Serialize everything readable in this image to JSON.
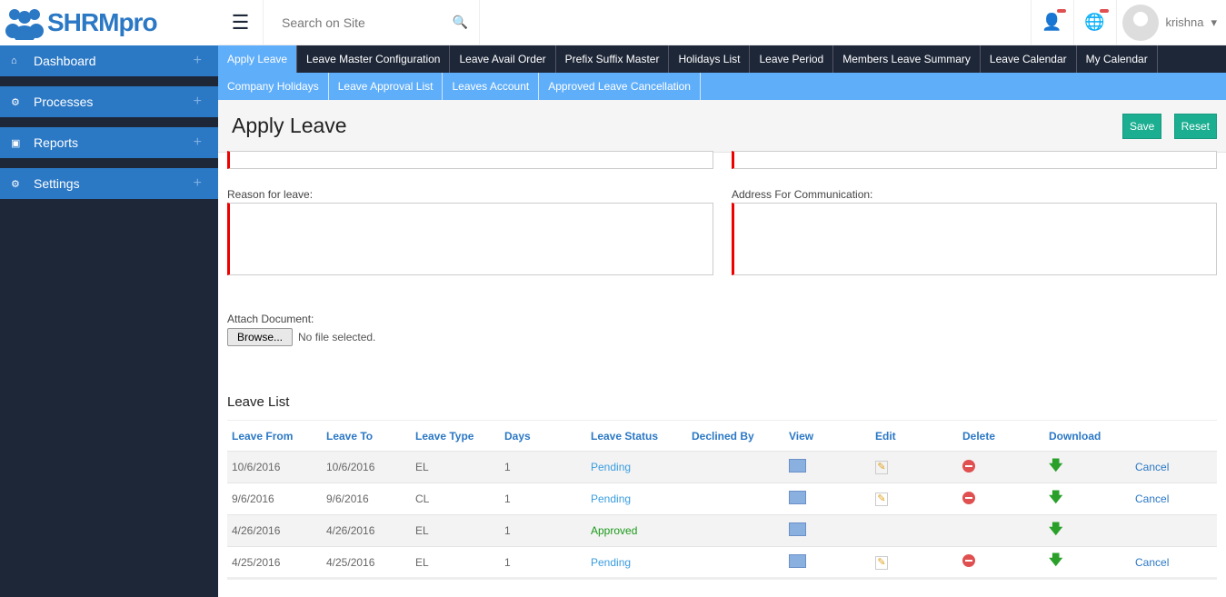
{
  "brand": "SHRMpro",
  "sidebar": {
    "items": [
      {
        "label": "Dashboard",
        "icon": "home-icon"
      },
      {
        "label": "Processes",
        "icon": "processes-icon"
      },
      {
        "label": "Reports",
        "icon": "briefcase-icon"
      },
      {
        "label": "Settings",
        "icon": "gear-icon"
      }
    ]
  },
  "topbar": {
    "search_placeholder": "Search on Site",
    "username": "krishna"
  },
  "tabs_row1": [
    "Apply Leave",
    "Leave Master Configuration",
    "Leave Avail Order",
    "Prefix Suffix Master",
    "Holidays List",
    "Leave Period",
    "Members Leave Summary",
    "Leave Calendar",
    "My Calendar"
  ],
  "tabs_row2": [
    "Company Holidays",
    "Leave Approval List",
    "Leaves Account",
    "Approved Leave Cancellation"
  ],
  "page": {
    "title": "Apply Leave",
    "save": "Save",
    "reset": "Reset"
  },
  "form": {
    "reason_label": "Reason for leave:",
    "address_label": "Address For Communication:",
    "attach_label": "Attach Document:",
    "browse": "Browse...",
    "no_file": "No file selected."
  },
  "leave_list": {
    "title": "Leave List",
    "headers": [
      "Leave From",
      "Leave To",
      "Leave Type",
      "Days",
      "Leave Status",
      "Declined By",
      "View",
      "Edit",
      "Delete",
      "Download",
      ""
    ],
    "rows": [
      {
        "from": "10/6/2016",
        "to": "10/6/2016",
        "type": "EL",
        "days": "1",
        "status": "Pending",
        "declined": "",
        "edit": true,
        "delete": true,
        "cancel": "Cancel"
      },
      {
        "from": "9/6/2016",
        "to": "9/6/2016",
        "type": "CL",
        "days": "1",
        "status": "Pending",
        "declined": "",
        "edit": true,
        "delete": true,
        "cancel": "Cancel"
      },
      {
        "from": "4/26/2016",
        "to": "4/26/2016",
        "type": "EL",
        "days": "1",
        "status": "Approved",
        "declined": "",
        "edit": false,
        "delete": false,
        "cancel": ""
      },
      {
        "from": "4/25/2016",
        "to": "4/25/2016",
        "type": "EL",
        "days": "1",
        "status": "Pending",
        "declined": "",
        "edit": true,
        "delete": true,
        "cancel": "Cancel"
      }
    ]
  }
}
